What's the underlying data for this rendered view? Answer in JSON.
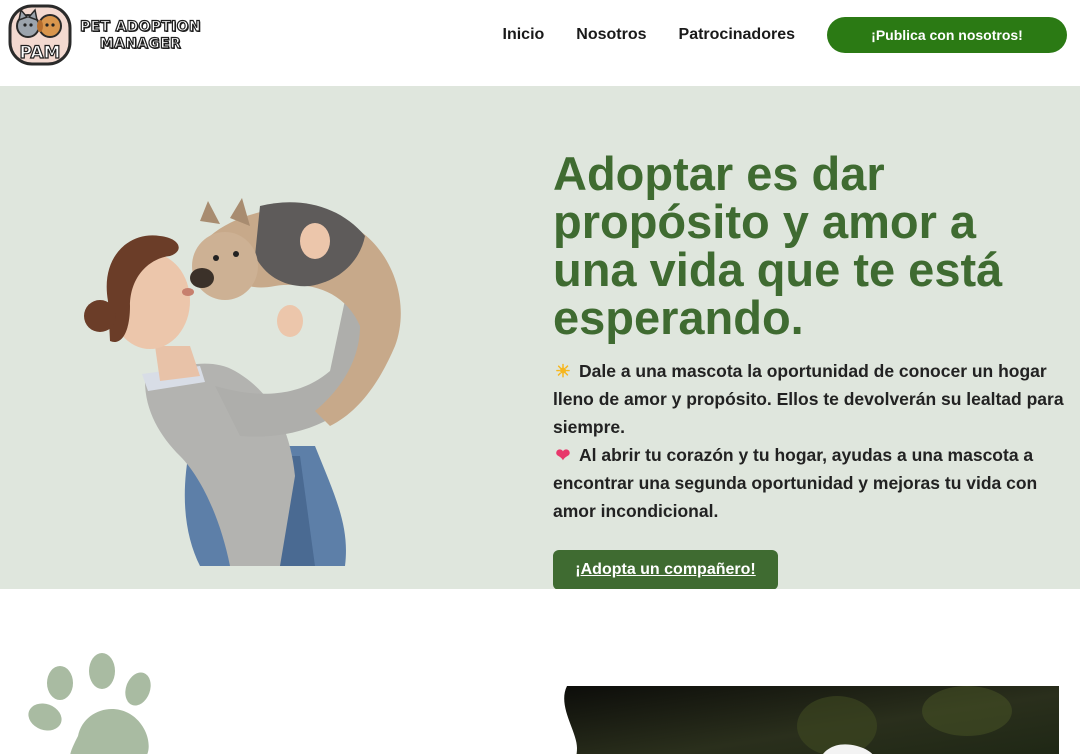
{
  "header": {
    "logo": {
      "badge_letters": "PAM",
      "line1": "PET ADOPTION",
      "line2": "MANAGER"
    },
    "nav": [
      {
        "label": "Inicio"
      },
      {
        "label": "Nosotros"
      },
      {
        "label": "Patrocinadores"
      }
    ],
    "publish_button": "¡Publica con nosotros!"
  },
  "hero": {
    "title": "Adoptar es dar propósito y amor a una vida que te está esperando.",
    "paragraphs": [
      {
        "icon": "sun-icon",
        "glyph": "☀",
        "text": "Dale a una mascota la oportunidad de conocer un hogar lleno de amor y propósito. Ellos te devolverán su lealtad para siempre."
      },
      {
        "icon": "heart-icon",
        "glyph": "❤",
        "text": "Al abrir tu corazón y tu hogar, ayudas a una mascota a encontrar una segunda oportunidad y mejoras tu vida con amor incondicional."
      }
    ],
    "cta_button": "¡Adopta un compañero!"
  },
  "colors": {
    "accent_green": "#2b7a14",
    "title_green": "#3f6b31",
    "hero_bg": "#dfe6dd",
    "paw_green": "#a9bba2"
  }
}
